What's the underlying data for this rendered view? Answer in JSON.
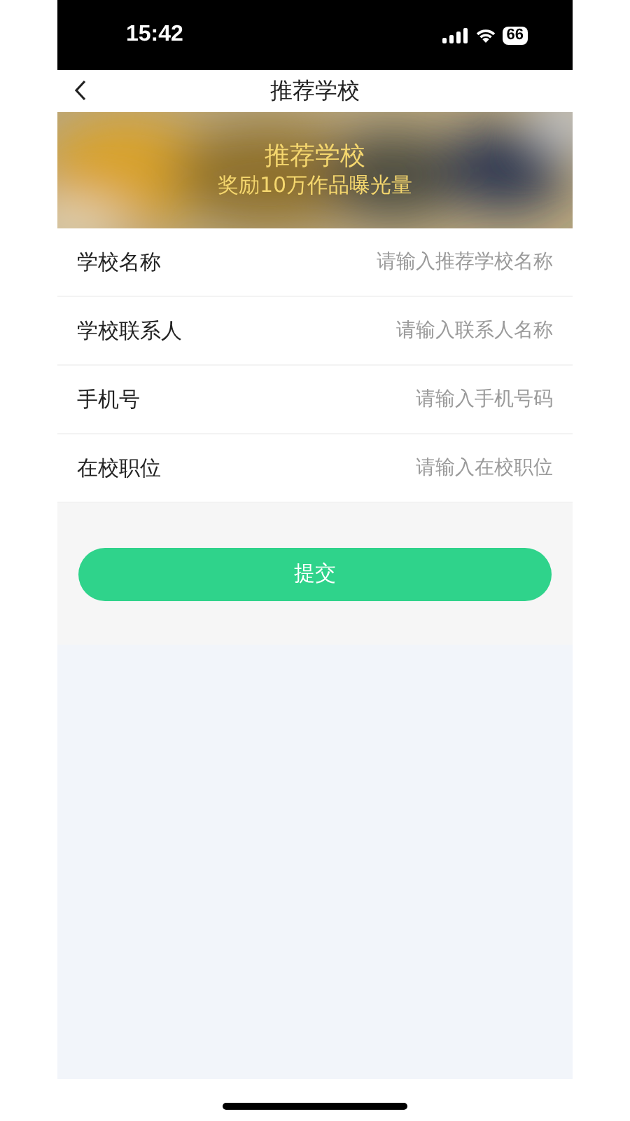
{
  "status_bar": {
    "time": "15:42",
    "battery": "66"
  },
  "nav": {
    "title": "推荐学校"
  },
  "banner": {
    "title": "推荐学校",
    "subtitle": "奖励10万作品曝光量"
  },
  "fields": [
    {
      "label": "学校名称",
      "placeholder": "请输入推荐学校名称"
    },
    {
      "label": "学校联系人",
      "placeholder": "请输入联系人名称"
    },
    {
      "label": "手机号",
      "placeholder": "请输入手机号码"
    },
    {
      "label": "在校职位",
      "placeholder": "请输入在校职位"
    }
  ],
  "submit_button": "提交"
}
